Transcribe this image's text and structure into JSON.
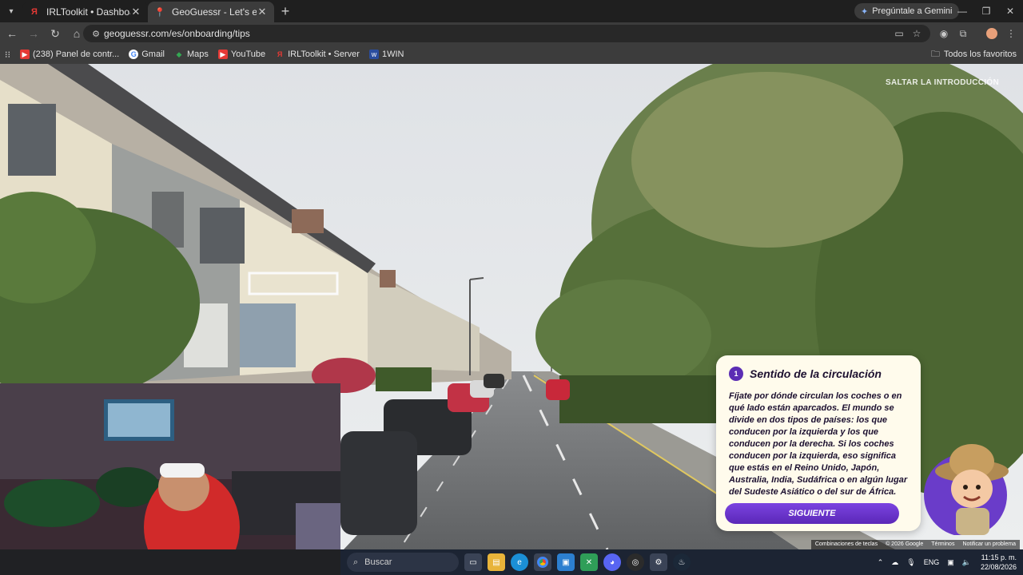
{
  "tabs": [
    {
      "title": "IRLToolkit • Dashboard",
      "icon": "irltoolkit-icon"
    },
    {
      "title": "GeoGuessr - Let's explore the w",
      "icon": "map-pin-icon"
    }
  ],
  "gemini_label": "Pregúntale a Gemini",
  "url": "geoguessr.com/es/onboarding/tips",
  "bookmarks": [
    {
      "label": "(238) Panel de contr...",
      "icon": "youtube-icon"
    },
    {
      "label": "Gmail",
      "icon": "google-icon"
    },
    {
      "label": "Maps",
      "icon": "maps-icon"
    },
    {
      "label": "YouTube",
      "icon": "youtube-icon"
    },
    {
      "label": "IRLToolkit • Server",
      "icon": "irltoolkit-icon"
    },
    {
      "label": "1WIN",
      "icon": "1win-icon"
    }
  ],
  "all_bookmarks": "Todos los favoritos",
  "skip_label": "SALTAR LA INTRODUCCIÓN",
  "tip": {
    "number": "1",
    "title": "Sentido de la circulación",
    "body": "Fíjate por dónde circulan los coches o en qué lado están aparcados. El mundo se divide en dos tipos de países: los que conducen por la izquierda y los que conducen por la derecha. Si los coches conducen por la izquierda, eso significa que estás en el Reino Unido, Japón, Australia, India, Sudáfrica o en algún lugar del Sudeste Asiático o del sur de África.",
    "button": "SIGUIENTE"
  },
  "credits": [
    "Combinaciones de teclas",
    "© 2026 Google",
    "Términos",
    "Notificar un problema"
  ],
  "taskbar": {
    "search": "Buscar",
    "lang": "ENG",
    "time": "11:15 p. m.",
    "date": "22/08/2026"
  },
  "colors": {
    "accent": "#5b2db4",
    "card": "#fffbec"
  }
}
